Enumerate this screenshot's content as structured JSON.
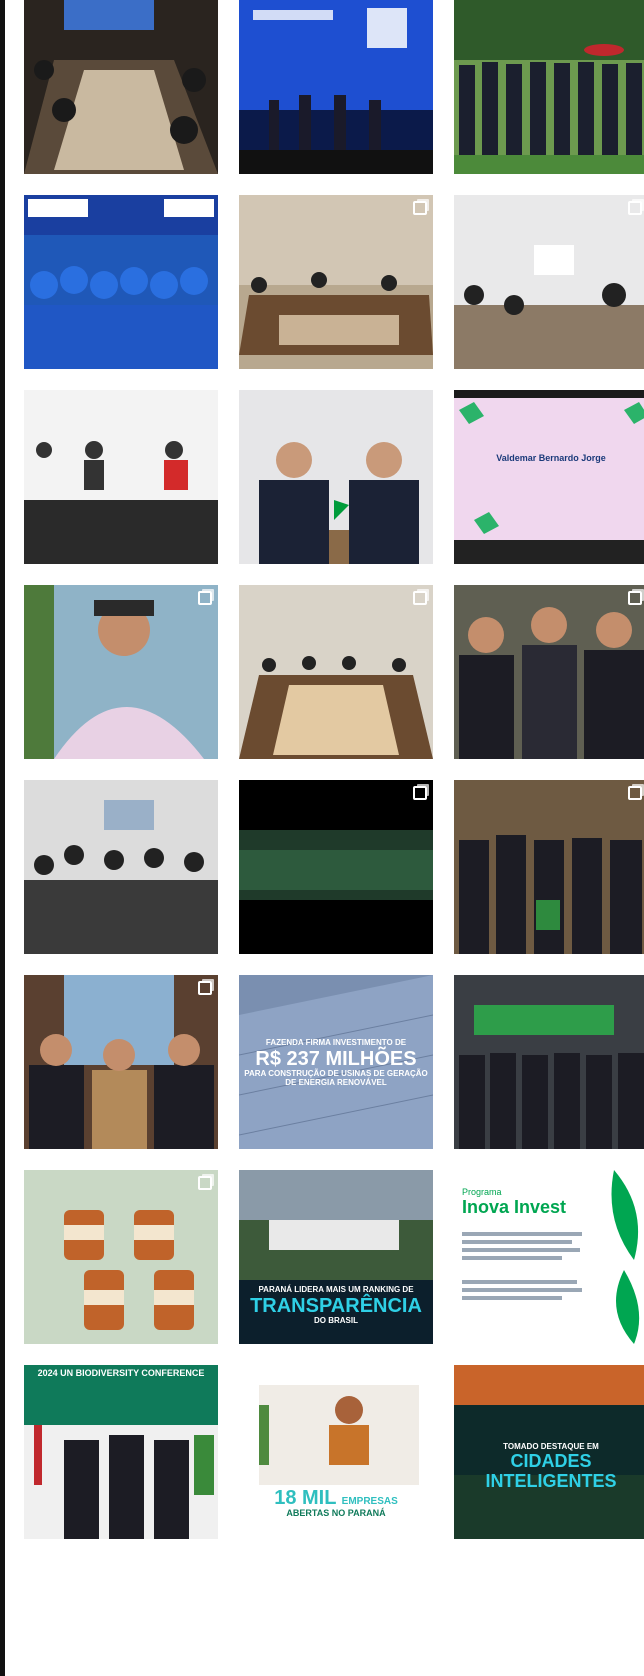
{
  "tiles": [
    {
      "id": "t1",
      "theme": "conference-table",
      "multi": false
    },
    {
      "id": "t2",
      "theme": "event-stage-blue",
      "multi": false
    },
    {
      "id": "t3",
      "theme": "group-outdoor",
      "multi": false
    },
    {
      "id": "t4",
      "theme": "team-blue-shirts",
      "multi": false
    },
    {
      "id": "t5",
      "theme": "meeting-room",
      "multi": true
    },
    {
      "id": "t6",
      "theme": "meeting-room-2",
      "multi": true
    },
    {
      "id": "t7",
      "theme": "panel-talk",
      "multi": false
    },
    {
      "id": "t8",
      "theme": "two-men-flags",
      "multi": false
    },
    {
      "id": "t9",
      "theme": "presentation-slide",
      "multi": false,
      "slide_name": "Valdemar Bernardo Jorge"
    },
    {
      "id": "t10",
      "theme": "portrait",
      "multi": true
    },
    {
      "id": "t11",
      "theme": "conference-table-2",
      "multi": true
    },
    {
      "id": "t12",
      "theme": "three-men",
      "multi": true
    },
    {
      "id": "t13",
      "theme": "office-meeting",
      "multi": false
    },
    {
      "id": "t14",
      "theme": "forest-video",
      "multi": true
    },
    {
      "id": "t15",
      "theme": "group-indoor",
      "multi": true
    },
    {
      "id": "t16",
      "theme": "three-men-window",
      "multi": true
    },
    {
      "id": "t17",
      "theme": "solar-panels",
      "multi": false,
      "line1": "FAZENDA FIRMA INVESTIMENTO DE",
      "line2": "R$ 237 MILHÕES",
      "line3": "PARA CONSTRUÇÃO DE USINAS DE GERAÇÃO DE ENERGIA RENOVÁVEL"
    },
    {
      "id": "t18",
      "theme": "group-expo",
      "multi": false
    },
    {
      "id": "t19",
      "theme": "honey-jars",
      "multi": true
    },
    {
      "id": "t20",
      "theme": "building-aerial",
      "multi": false,
      "line1": "PARANÁ LIDERA MAIS UM RANKING DE",
      "line2": "TRANSPARÊNCIA",
      "line3": "DO BRASIL"
    },
    {
      "id": "t21",
      "theme": "inova-invest",
      "multi": false,
      "line1": "Programa",
      "line2": "Inova Invest"
    },
    {
      "id": "t22",
      "theme": "biodiversity",
      "multi": false,
      "line1": "2024 UN BIODIVERSITY CONFERENCE"
    },
    {
      "id": "t23",
      "theme": "companies",
      "multi": false,
      "line1": "18 MIL",
      "line1b": "EMPRESAS",
      "line2": "ABERTAS NO PARANÁ"
    },
    {
      "id": "t24",
      "theme": "city-night",
      "multi": false,
      "line1": "TOMADO DESTAQUE EM",
      "line2": "CIDADES INTELIGENTES"
    }
  ],
  "colors": {
    "frame": "#111111",
    "green": "#00a651",
    "blue": "#1e4fd1"
  }
}
